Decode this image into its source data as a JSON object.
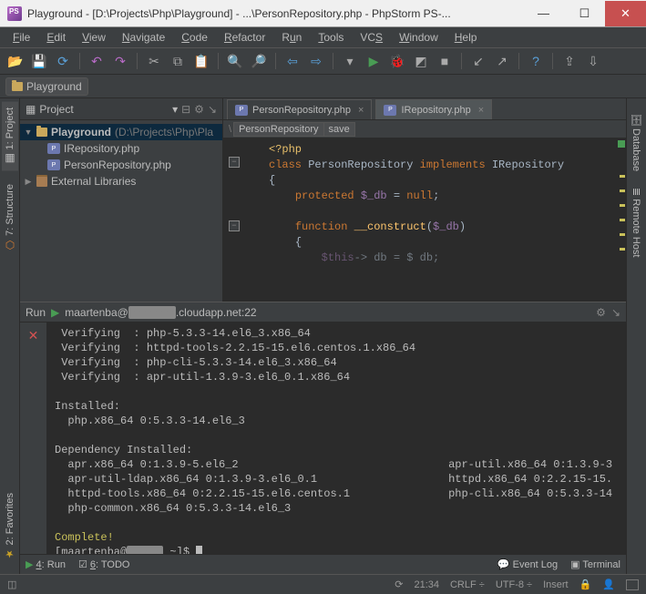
{
  "window": {
    "title": "Playground - [D:\\Projects\\Php\\Playground] - ...\\PersonRepository.php - PhpStorm PS-..."
  },
  "menu": [
    "File",
    "Edit",
    "View",
    "Navigate",
    "Code",
    "Refactor",
    "Run",
    "Tools",
    "VCS",
    "Window",
    "Help"
  ],
  "breadcrumb": {
    "root": "Playground"
  },
  "project": {
    "tab_label": "Project",
    "root_name": "Playground",
    "root_path": "(D:\\Projects\\Php\\Pla",
    "files": [
      "IRepository.php",
      "PersonRepository.php"
    ],
    "external_libs": "External Libraries"
  },
  "left_tabs": {
    "project": "1: Project",
    "structure": "7: Structure",
    "favorites": "2: Favorites"
  },
  "right_tabs": {
    "database": "Database",
    "remote_host": "Remote Host"
  },
  "editor": {
    "tabs": [
      {
        "label": "PersonRepository.php",
        "active": true
      },
      {
        "label": "IRepository.php",
        "active": false
      }
    ],
    "crumbs": [
      "PersonRepository",
      "save"
    ],
    "code": {
      "l1": "<?php",
      "l2a": "class",
      "l2b": "PersonRepository",
      "l2c": "implements",
      "l2d": "IRepository",
      "l3": "{",
      "l4a": "protected",
      "l4b": "$_db",
      "l4c": " = ",
      "l4d": "null",
      "l4e": ";",
      "l5a": "function",
      "l5b": "__construct",
      "l5c": "(",
      "l5d": "$_db",
      "l5e": ")",
      "l6": "{",
      "l7a": "$this",
      "l7b": "-> db = $ db;"
    }
  },
  "run": {
    "label": "Run",
    "session_prefix": "maartenba@",
    "session_host": ".cloudapp.net:22",
    "lines": [
      " Verifying  : php-5.3.3-14.el6_3.x86_64",
      " Verifying  : httpd-tools-2.2.15-15.el6.centos.1.x86_64",
      " Verifying  : php-cli-5.3.3-14.el6_3.x86_64",
      " Verifying  : apr-util-1.3.9-3.el6_0.1.x86_64",
      "",
      "Installed:",
      "  php.x86_64 0:5.3.3-14.el6_3",
      "",
      "Dependency Installed:",
      "  apr.x86_64 0:1.3.9-5.el6_2                                apr-util.x86_64 0:1.3.9-3",
      "  apr-util-ldap.x86_64 0:1.3.9-3.el6_0.1                    httpd.x86_64 0:2.2.15-15.",
      "  httpd-tools.x86_64 0:2.2.15-15.el6.centos.1               php-cli.x86_64 0:5.3.3-14",
      "  php-common.x86_64 0:5.3.3-14.el6_3",
      ""
    ],
    "complete": "Complete!",
    "prompt_prefix": "[maartenba@",
    "prompt_suffix": " ~]$ "
  },
  "bottom_tools": {
    "run": "4: Run",
    "todo": "6: TODO",
    "event_log": "Event Log",
    "terminal": "Terminal"
  },
  "status": {
    "pos": "21:34",
    "le": "CRLF",
    "enc": "UTF-8",
    "mode": "Insert"
  }
}
